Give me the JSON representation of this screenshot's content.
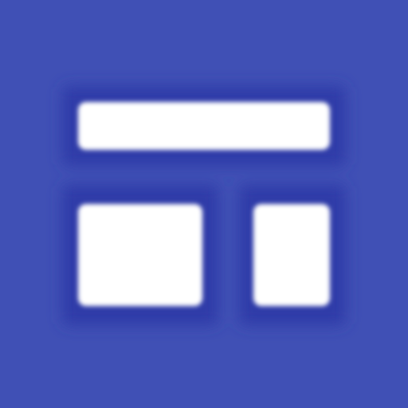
{
  "icon": {
    "name": "layout-grid-icon",
    "background_color": "#4050b5",
    "tile_color": "#ffffff",
    "outline_color": "#2f3aa8"
  }
}
